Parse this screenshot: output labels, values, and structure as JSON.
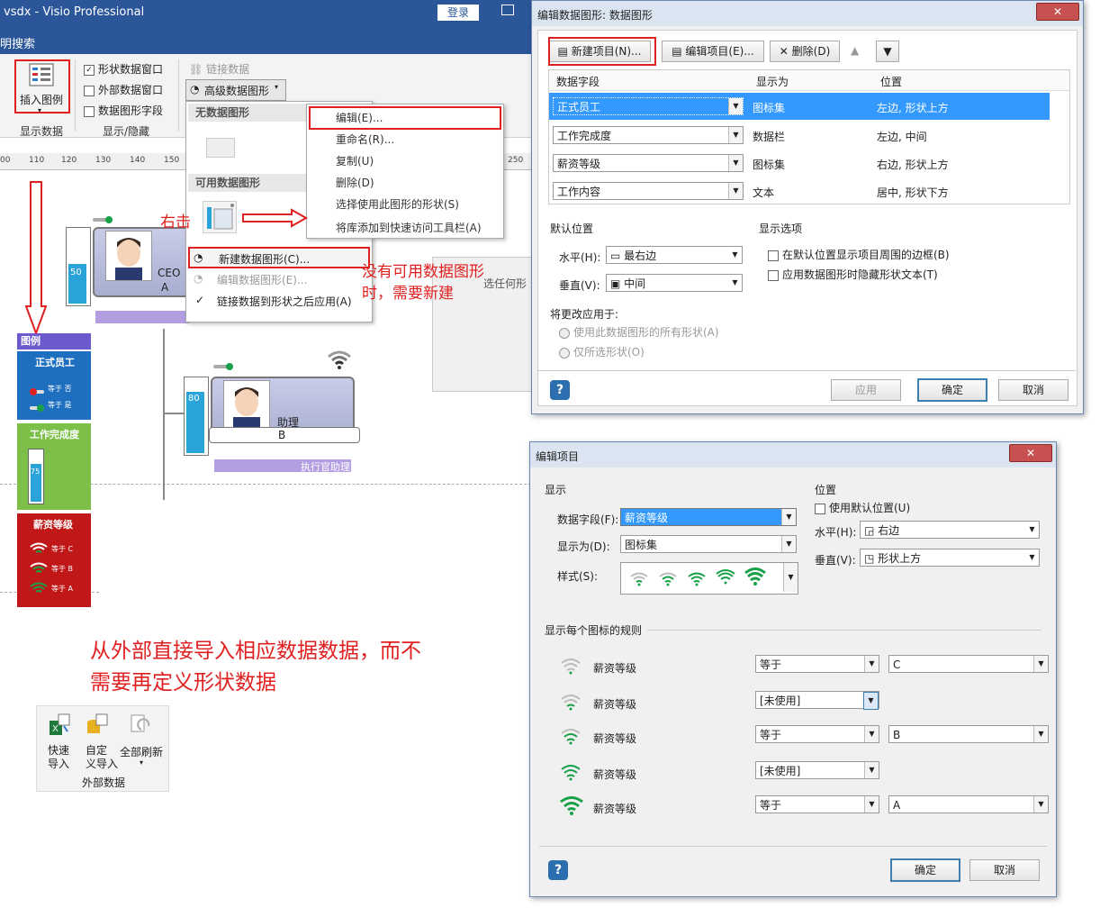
{
  "window": {
    "title": "vsdx  -  Visio Professional",
    "login": "登录",
    "tab": "明搜索"
  },
  "ribbon": {
    "insert_legend": "插入图例",
    "show_data_group": "显示数据",
    "checkboxes": [
      {
        "label": "形状数据窗口",
        "checked": true
      },
      {
        "label": "外部数据窗口",
        "checked": false
      },
      {
        "label": "数据图形字段",
        "checked": false
      }
    ],
    "show_hide_group": "显示/隐藏",
    "link_data": "链接数据",
    "advanced_data_graphics": "高级数据图形"
  },
  "ruler": {
    "ticks": [
      "00",
      "110",
      "120",
      "130",
      "140",
      "150",
      "160",
      "250"
    ]
  },
  "dropdown": {
    "no_data_graphic": "无数据图形",
    "available_graphics": "可用数据图形",
    "items": [
      {
        "label": "新建数据图形(C)...",
        "enabled": true
      },
      {
        "label": "编辑数据图形(E)...",
        "enabled": false
      },
      {
        "label": "链接数据到形状之后应用(A)",
        "enabled": true,
        "checked": true
      }
    ]
  },
  "context_menu": {
    "items": [
      "编辑(E)...",
      "重命名(R)...",
      "复制(U)",
      "删除(D)",
      "选择使用此图形的形状(S)",
      "将库添加到快速访问工具栏(A)"
    ]
  },
  "annotations": {
    "right_click": "右击",
    "need_new": "没有可用数据图形时，需要新建",
    "import_note": "从外部直接导入相应数据数据，而不需要再定义形状数据"
  },
  "canvas": {
    "ceo": {
      "title": "CEO",
      "name": "A",
      "bar_value": "50"
    },
    "assistant": {
      "title": "助理",
      "name": "B",
      "bar_value": "80",
      "role_bar": "执行官助理"
    },
    "select_hint": "选任何形"
  },
  "legend": {
    "title": "图例",
    "sections": [
      {
        "title": "正式员工",
        "rows": [
          "等于 否",
          "等于 是"
        ],
        "color": "#1e6fc0"
      },
      {
        "title": "工作完成度",
        "rows": [
          "75"
        ],
        "color": "#7cc04a"
      },
      {
        "title": "薪资等级",
        "rows": [
          "等于 C",
          "等于 B",
          "等于 A"
        ],
        "color": "#c01818"
      }
    ]
  },
  "external_data": {
    "quick_import": "快速\n导入",
    "custom_import": "自定\n义导入",
    "refresh_all": "全部刷新",
    "group": "外部数据"
  },
  "dialog1": {
    "title": "编辑数据图形: 数据图形",
    "new_item": "新建项目(N)...",
    "edit_item": "编辑项目(E)...",
    "delete": "删除(D)",
    "columns": [
      "数据字段",
      "显示为",
      "位置"
    ],
    "rows": [
      {
        "field": "正式员工",
        "display": "图标集",
        "position": "左边, 形状上方"
      },
      {
        "field": "工作完成度",
        "display": "数据栏",
        "position": "左边, 中间"
      },
      {
        "field": "薪资等级",
        "display": "图标集",
        "position": "右边, 形状上方"
      },
      {
        "field": "工作内容",
        "display": "文本",
        "position": "居中, 形状下方"
      }
    ],
    "default_position": "默认位置",
    "horizontal_label": "水平(H):",
    "horizontal_value": "最右边",
    "vertical_label": "垂直(V):",
    "vertical_value": "中间",
    "display_options": "显示选项",
    "opt_border": "在默认位置显示项目周围的边框(B)",
    "opt_hide_text": "应用数据图形时隐藏形状文本(T)",
    "apply_to": "将更改应用于:",
    "apply_all": "使用此数据图形的所有形状(A)",
    "apply_selected": "仅所选形状(O)",
    "apply": "应用",
    "ok": "确定",
    "cancel": "取消"
  },
  "dialog2": {
    "title": "编辑项目",
    "display": "显示",
    "field_label": "数据字段(F):",
    "field_value": "薪资等级",
    "display_as_label": "显示为(D):",
    "display_as_value": "图标集",
    "style_label": "样式(S):",
    "position": "位置",
    "use_default": "使用默认位置(U)",
    "horizontal_label": "水平(H):",
    "horizontal_value": "右边",
    "vertical_label": "垂直(V):",
    "vertical_value": "形状上方",
    "rules_header": "显示每个图标的规则",
    "rules": [
      {
        "field": "薪资等级",
        "op": "等于",
        "value": "C",
        "used": true,
        "level": 1
      },
      {
        "field": "薪资等级",
        "op": "[未使用]",
        "value": "",
        "used": false,
        "level": 2
      },
      {
        "field": "薪资等级",
        "op": "等于",
        "value": "B",
        "used": true,
        "level": 3
      },
      {
        "field": "薪资等级",
        "op": "[未使用]",
        "value": "",
        "used": false,
        "level": 4
      },
      {
        "field": "薪资等级",
        "op": "等于",
        "value": "A",
        "used": true,
        "level": 5
      }
    ],
    "ok": "确定",
    "cancel": "取消"
  }
}
